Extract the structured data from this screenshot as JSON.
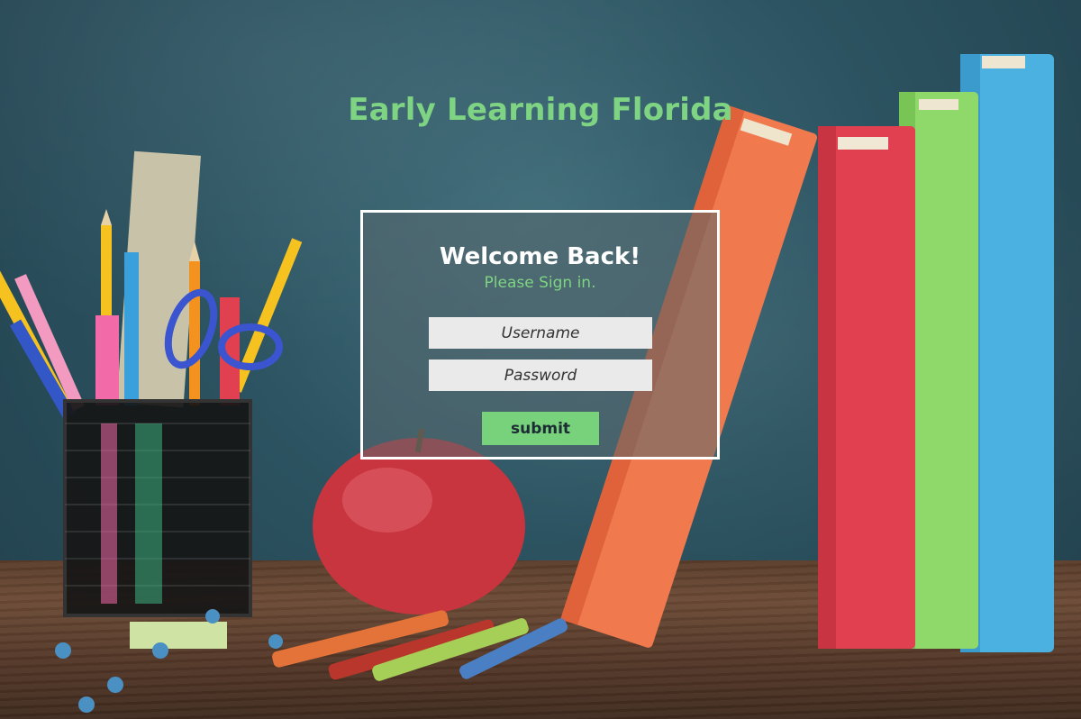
{
  "header": {
    "title": "Early Learning Florida"
  },
  "login": {
    "heading": "Welcome Back!",
    "subheading": "Please Sign in.",
    "username_placeholder": "Username",
    "password_placeholder": "Password",
    "submit_label": "submit"
  },
  "colors": {
    "accent": "#7ed482",
    "button_bg": "#78d27c",
    "panel_border": "#ffffff",
    "chalkboard": "#2c5361"
  },
  "background": {
    "items": [
      "chalkboard",
      "wooden-desk",
      "pencil-cup",
      "ruler",
      "scissors",
      "apple",
      "crayons",
      "push-pins",
      "books"
    ]
  }
}
